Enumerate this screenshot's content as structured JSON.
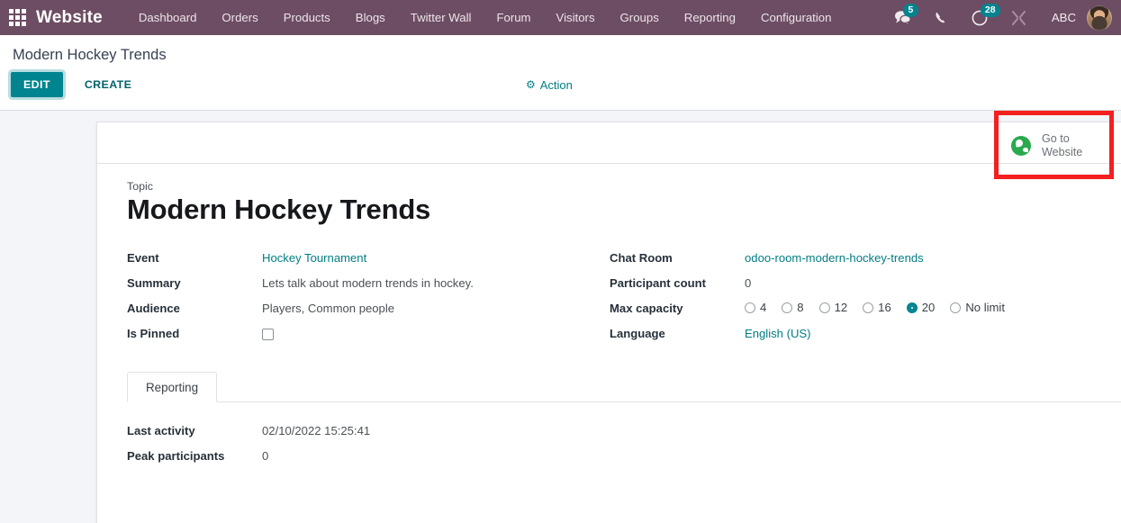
{
  "navbar": {
    "apps_icon": "apps-grid-icon",
    "brand": "Website",
    "menu_items": [
      {
        "label": "Dashboard"
      },
      {
        "label": "Orders"
      },
      {
        "label": "Products"
      },
      {
        "label": "Blogs"
      },
      {
        "label": "Twitter Wall"
      },
      {
        "label": "Forum"
      },
      {
        "label": "Visitors"
      },
      {
        "label": "Groups"
      },
      {
        "label": "Reporting"
      },
      {
        "label": "Configuration"
      }
    ],
    "systray": {
      "messages_icon": "chat-bubble-icon",
      "messages_count": "5",
      "phone_icon": "phone-icon",
      "activities_icon": "clock-icon",
      "activities_count": "28",
      "debug_icon": "wrench-tools-icon",
      "user_name": "ABC",
      "avatar": "user-avatar"
    },
    "colors": {
      "navbar_bg": "#6d4d63",
      "badge_bg": "#00848f"
    }
  },
  "control_panel": {
    "breadcrumb": "Modern Hockey Trends",
    "edit_label": "EDIT",
    "create_label": "CREATE",
    "action_label": "Action",
    "action_icon": "gear-icon"
  },
  "sheet": {
    "goto_website": {
      "label": "Go to\nWebsite",
      "icon": "globe-icon"
    },
    "topic_label": "Topic",
    "topic_value": "Modern Hockey Trends",
    "left_fields": [
      {
        "label": "Event",
        "value": "Hockey Tournament",
        "type": "link"
      },
      {
        "label": "Summary",
        "value": "Lets talk about modern trends in hockey.",
        "type": "text"
      },
      {
        "label": "Audience",
        "value": "Players, Common people",
        "type": "text"
      },
      {
        "label": "Is Pinned",
        "value": "",
        "type": "checkbox",
        "checked": false
      }
    ],
    "right_fields": [
      {
        "label": "Chat Room",
        "value": "odoo-room-modern-hockey-trends",
        "type": "link"
      },
      {
        "label": "Participant count",
        "value": "0",
        "type": "text"
      },
      {
        "label": "Max capacity",
        "value": "20",
        "type": "radio"
      },
      {
        "label": "Language",
        "value": "English (US)",
        "type": "link"
      }
    ],
    "max_capacity_options": [
      {
        "label": "4",
        "selected": false
      },
      {
        "label": "8",
        "selected": false
      },
      {
        "label": "12",
        "selected": false
      },
      {
        "label": "16",
        "selected": false
      },
      {
        "label": "20",
        "selected": true
      },
      {
        "label": "No limit",
        "selected": false
      }
    ],
    "notebook": {
      "tabs": [
        {
          "label": "Reporting",
          "active": true
        }
      ],
      "page_fields": [
        {
          "label": "Last activity",
          "value": "02/10/2022 15:25:41"
        },
        {
          "label": "Peak participants",
          "value": "0"
        }
      ]
    }
  },
  "annotation": {
    "color": "#f41f1f",
    "target": "go-to-website-button"
  }
}
